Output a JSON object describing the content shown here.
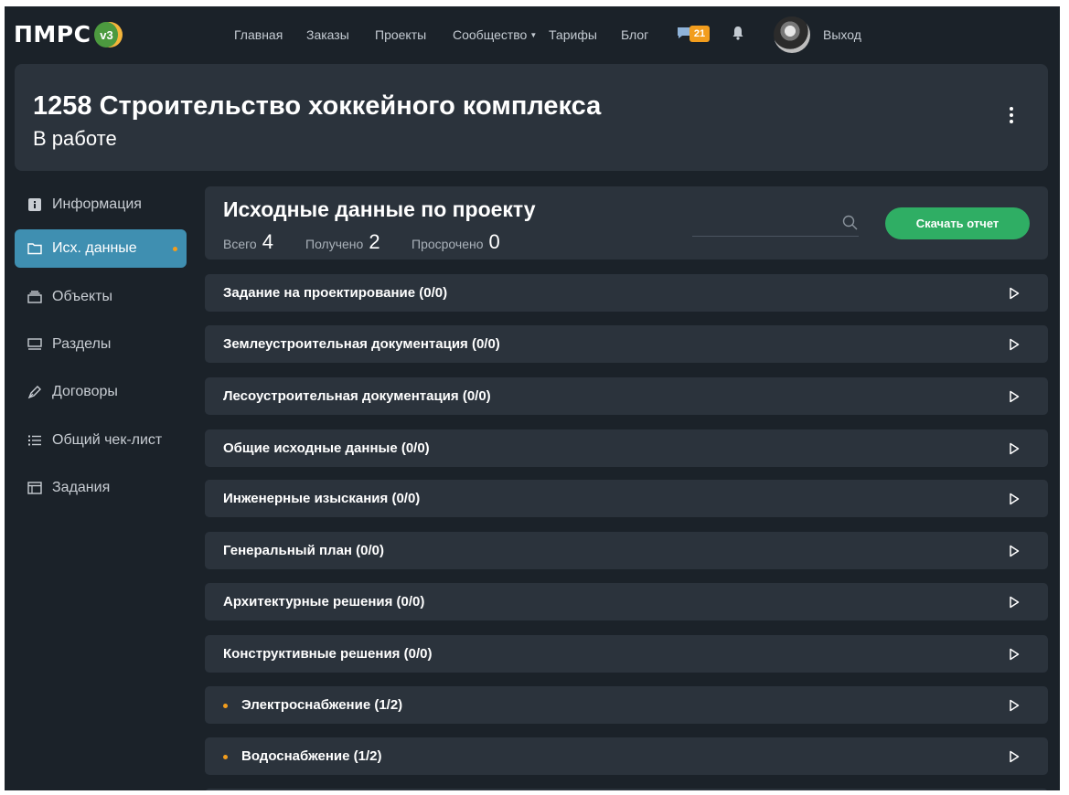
{
  "brand": {
    "logo_text": "ПМРС",
    "version": "v3"
  },
  "nav": {
    "items": [
      {
        "label": "Главная"
      },
      {
        "label": "Заказы"
      },
      {
        "label": "Проекты"
      },
      {
        "label": "Сообщество",
        "has_dropdown": true
      },
      {
        "label": "Тарифы"
      },
      {
        "label": "Блог"
      }
    ],
    "messages_count": "21",
    "logout_label": "Выход"
  },
  "project": {
    "title": "1258 Строительство хоккейного комплекса",
    "status": "В работе"
  },
  "sidebar": {
    "items": [
      {
        "label": "Информация",
        "icon": "info-icon"
      },
      {
        "label": "Исх. данные",
        "icon": "folder-icon",
        "active": true,
        "has_dot": true
      },
      {
        "label": "Объекты",
        "icon": "objects-icon"
      },
      {
        "label": "Разделы",
        "icon": "sections-icon"
      },
      {
        "label": "Договоры",
        "icon": "pen-icon"
      },
      {
        "label": "Общий чек-лист",
        "icon": "checklist-icon"
      },
      {
        "label": "Задания",
        "icon": "tasks-icon"
      }
    ]
  },
  "data_section": {
    "title": "Исходные данные по проекту",
    "stats": [
      {
        "label": "Всего",
        "value": "4"
      },
      {
        "label": "Получено",
        "value": "2"
      },
      {
        "label": "Просрочено",
        "value": "0"
      }
    ],
    "search": {
      "placeholder": "",
      "value": ""
    },
    "download_label": "Скачать отчет"
  },
  "rows": [
    {
      "label": "Задание на проектирование (0/0)",
      "has_dot": false
    },
    {
      "label": "Землеустроительная документация (0/0)",
      "has_dot": false
    },
    {
      "label": "Лесоустроительная документация (0/0)",
      "has_dot": false
    },
    {
      "label": "Общие исходные данные (0/0)",
      "has_dot": false
    },
    {
      "label": "Инженерные изыскания (0/0)",
      "has_dot": false
    },
    {
      "label": "Генеральный план (0/0)",
      "has_dot": false
    },
    {
      "label": "Архитектурные решения (0/0)",
      "has_dot": false
    },
    {
      "label": "Конструктивные решения (0/0)",
      "has_dot": false
    },
    {
      "label": "Электроснабжение (1/2)",
      "has_dot": true
    },
    {
      "label": "Водоснабжение (1/2)",
      "has_dot": true
    }
  ],
  "colors": {
    "background": "#1b2229",
    "card": "#2b333c",
    "active_sidebar": "#3f8fb1",
    "accent_orange": "#f29d1d",
    "download_button": "#2fae64"
  }
}
